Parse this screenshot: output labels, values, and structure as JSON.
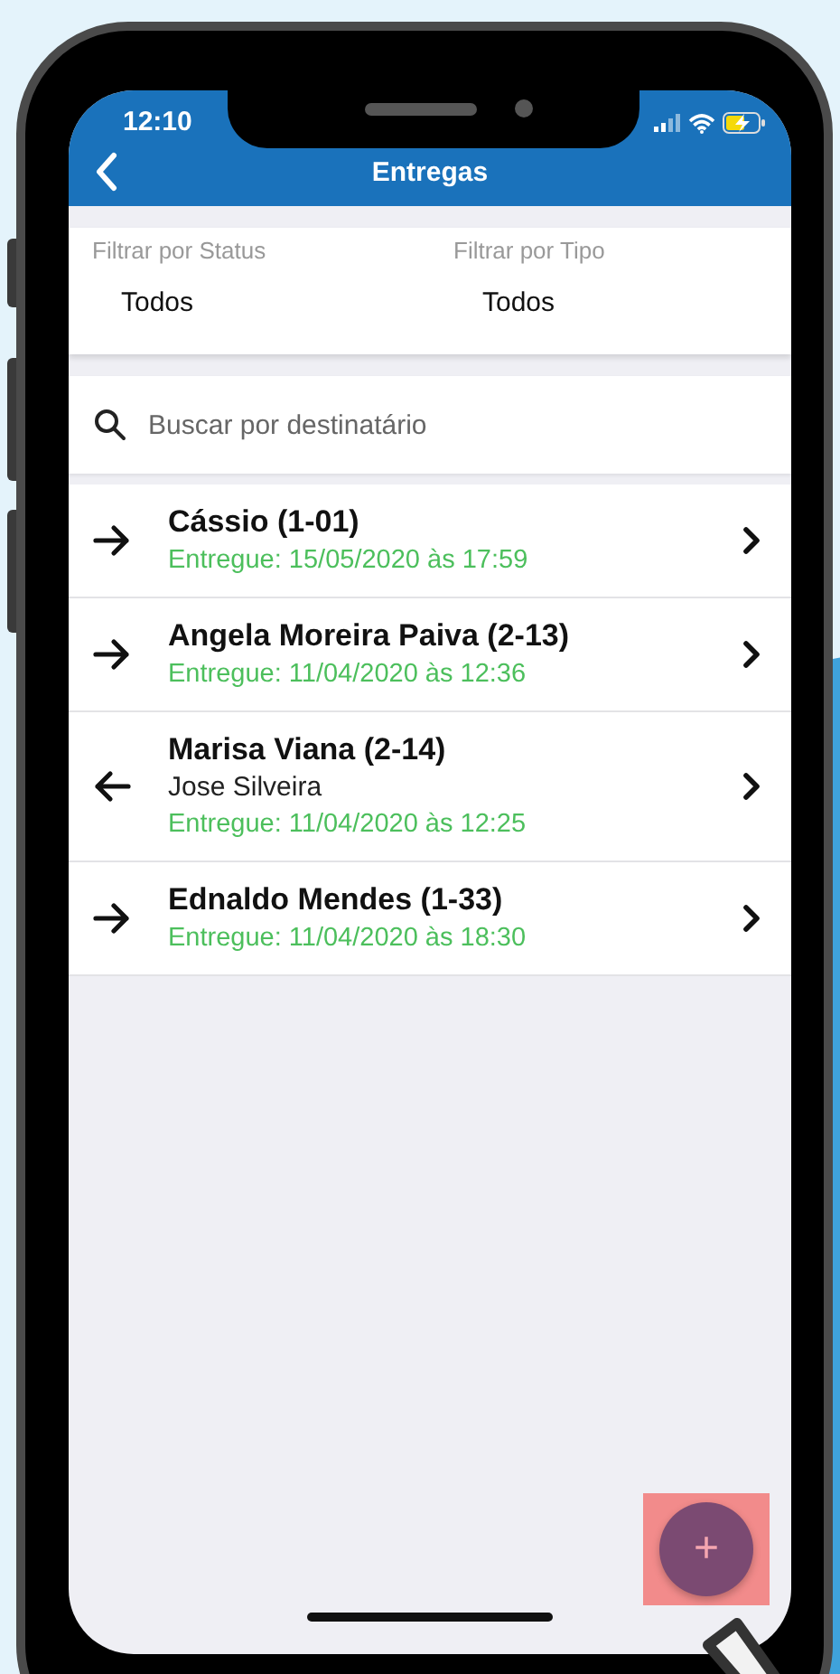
{
  "status_bar": {
    "time": "12:10"
  },
  "nav_bar": {
    "title": "Entregas"
  },
  "filters": [
    {
      "label": "Filtrar por Status",
      "value": "Todos"
    },
    {
      "label": "Filtrar por Tipo",
      "value": "Todos"
    }
  ],
  "search": {
    "placeholder": "Buscar por destinatário"
  },
  "deliveries": [
    {
      "kind": "outgoing",
      "name": "Cássio  (1-01)",
      "status": "Entregue: 15/05/2020 às 17:59"
    },
    {
      "kind": "outgoing",
      "name": "Angela Moreira Paiva (2-13)",
      "status": "Entregue: 11/04/2020 às 12:36"
    },
    {
      "kind": "incoming",
      "name": "Marisa Viana (2-14)",
      "recipient": "Jose Silveira",
      "status": "Entregue: 11/04/2020 às 12:25"
    },
    {
      "kind": "outgoing",
      "name": "Ednaldo Mendes (1-33)",
      "status": "Entregue: 11/04/2020 às 18:30"
    }
  ],
  "fab": {
    "label": "+"
  }
}
